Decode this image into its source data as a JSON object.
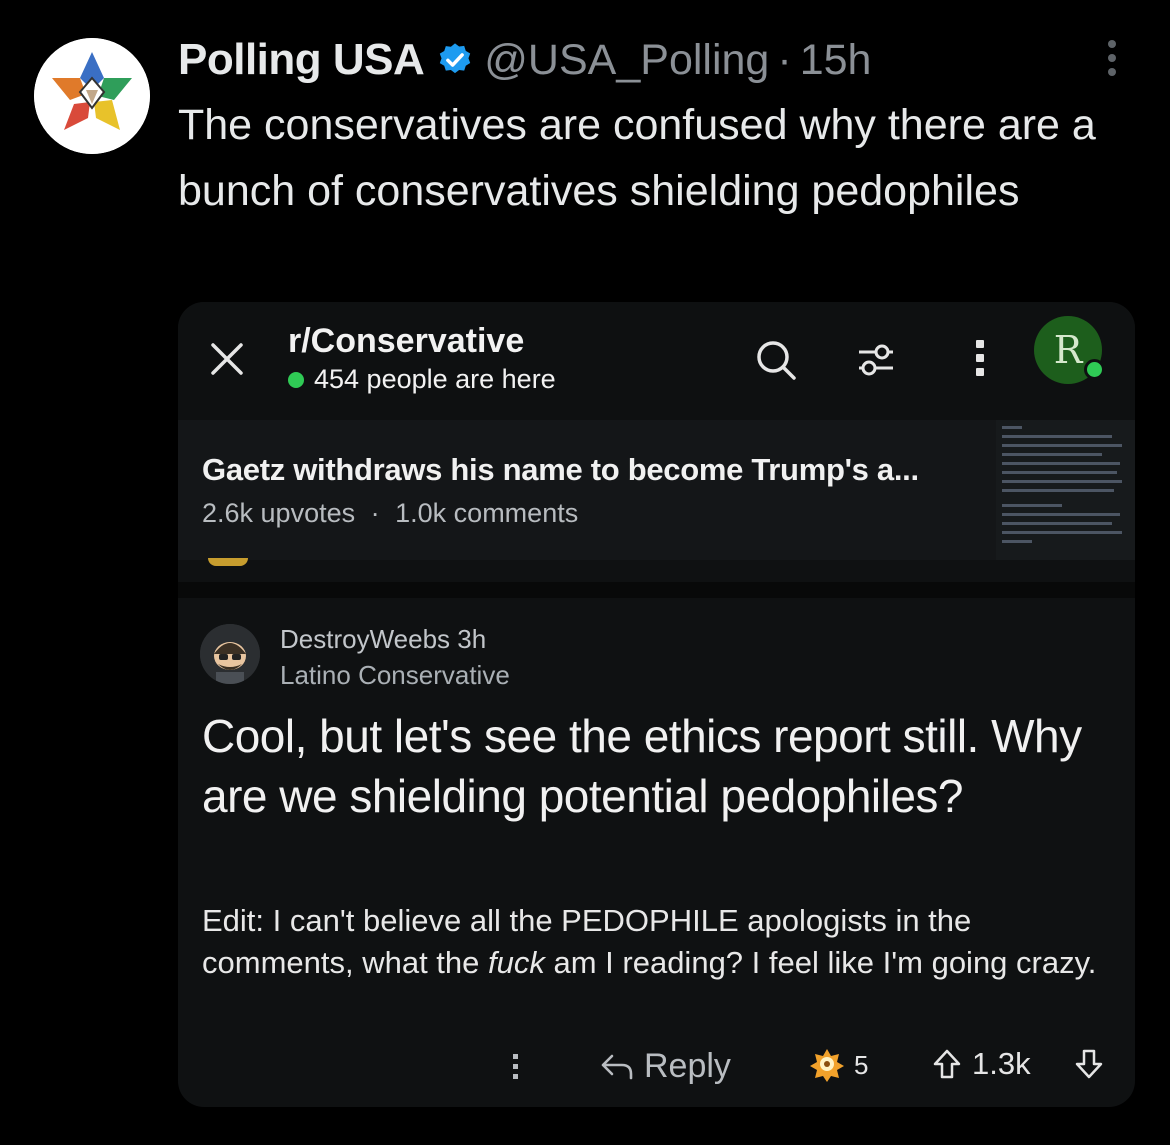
{
  "tweet": {
    "author_name": "Polling USA",
    "handle": "@USA_Polling",
    "separator": "·",
    "time": "15h",
    "text": "The conservatives are confused why there are a bunch of conservatives shielding pedophiles",
    "verified_color": "#1d9bf0"
  },
  "reddit": {
    "subreddit": "r/Conservative",
    "online_count": "454 people are here",
    "subreddit_avatar_letter": "R",
    "post": {
      "title": "Gaetz withdraws his name to become Trump's a...",
      "upvotes": "2.6k upvotes",
      "separator": "·",
      "comments": "1.0k comments"
    },
    "comment": {
      "username": "DestroyWeebs",
      "time": "3h",
      "flair": "Latino Conservative",
      "body": "Cool, but let's see the ethics report still. Why are we shielding potential pedophiles?",
      "edit_prefix": "Edit: I can't believe all the PEDOPHILE apologists in the comments, what the ",
      "edit_emphasis": "fuck",
      "edit_suffix": " am I reading? I feel like I'm going crazy.",
      "reply_label": "Reply",
      "award_count": "5",
      "score": "1.3k"
    }
  },
  "icons": [
    "avatar-logo",
    "verified-badge-icon",
    "more-icon",
    "close-icon",
    "search-icon",
    "filter-icon",
    "kebab-icon",
    "reply-icon",
    "award-icon",
    "upvote-icon",
    "downvote-icon"
  ]
}
